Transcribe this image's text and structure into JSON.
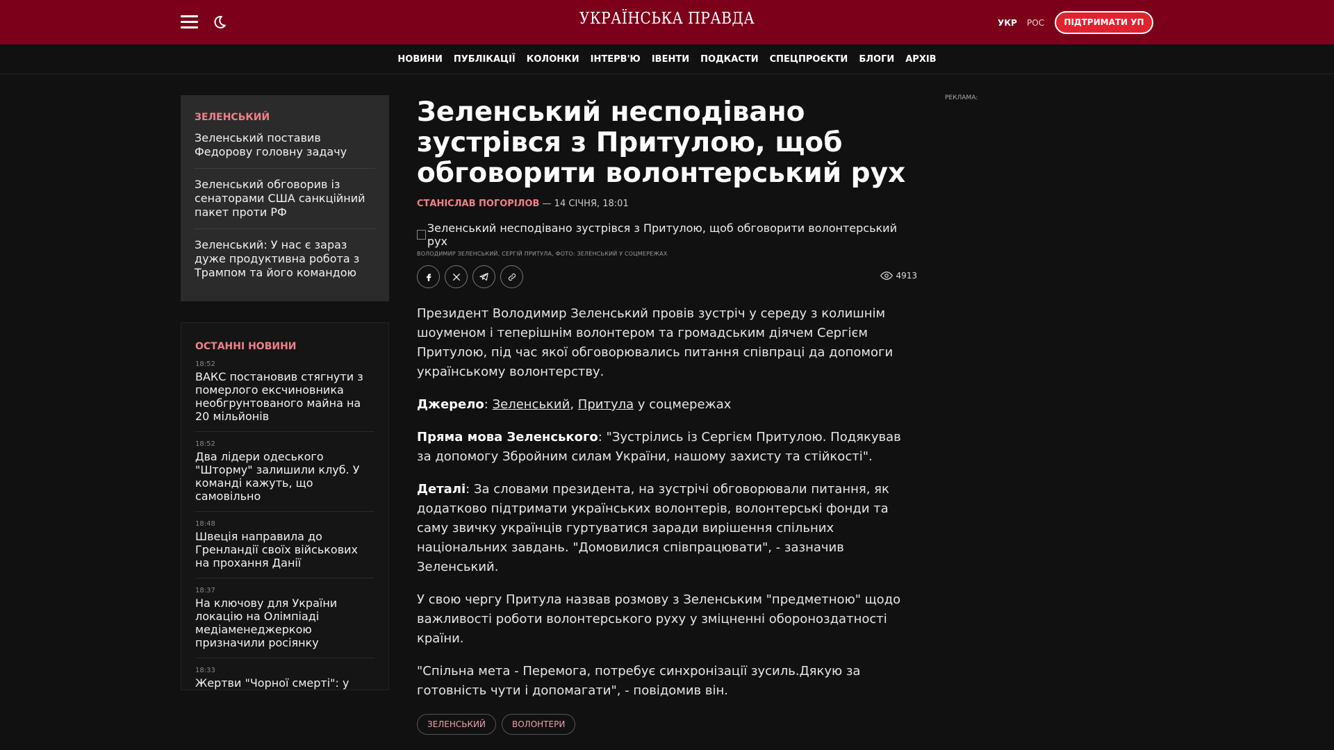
{
  "header": {
    "logo": "УКРАЇНСЬКА ПРАВДА",
    "lang_ukr": "УКР",
    "lang_ros": "РОС",
    "support_label": "ПІДТРИМАТИ УП",
    "accent_color": "#7c0019"
  },
  "nav": {
    "items": [
      "НОВИНИ",
      "ПУБЛІКАЦІЇ",
      "КОЛОНКИ",
      "ІНТЕРВ'Ю",
      "ІВЕНТИ",
      "ПОДКАСТИ",
      "СПЕЦПРОЄКТИ",
      "БЛОГИ",
      "АРХІВ"
    ]
  },
  "topic_box": {
    "title": "ЗЕЛЕНСЬКИЙ",
    "items": [
      "Зеленський поставив Федорову головну задачу",
      "Зеленський обговорив із сенаторами США санкційний пакет проти РФ",
      "Зеленський: У нас є зараз дуже продуктивна робота з Трампом та його командою"
    ]
  },
  "latest": {
    "title": "ОСТАННІ НОВИНИ",
    "items": [
      {
        "time": "18:52",
        "title": "ВАКС постановив стягнути з померлого ексчиновника необгрунтованого майна на 20 мільйонів"
      },
      {
        "time": "18:52",
        "title": "Два лідери одеського \"Шторму\" залишили клуб. У команді кажуть, що самовільно"
      },
      {
        "time": "18:48",
        "title": "Швеція направила до Гренландії своїх військових на прохання Данії"
      },
      {
        "time": "18:37",
        "title": "На ключову для України локацію на Олімпіаді медіаменеджеркою призначили росіянку"
      },
      {
        "time": "18:33",
        "title": "Жертви \"Чорної смерті\": у Німеччині виявили"
      }
    ]
  },
  "article": {
    "headline": "Зеленський несподівано зустрівся з Притулою, щоб обговорити волонтерський рух",
    "author": "СТАНІСЛАВ ПОГОРІЛОВ",
    "date": " — 14 СІЧНЯ, 18:01",
    "photo_alt": "Зеленський несподівано зустрівся з Притулою, щоб обговорити волонтерський рух",
    "caption": "ВОЛОДИМИР ЗЕЛЕНСЬКИЙ, СЕРГІЙ ПРИТУЛА, ФОТО: ЗЕЛЕНСЬКИЙ У СОЦМЕРЕЖАХ",
    "views": "4913",
    "lead": "Президент Володимир Зеленський провів зустріч у середу з колишнім шоуменом і теперішнім волонтером та громадським діячем Сергієм Притулою, під час якої обговорювались питання співпраці да допомоги українському волонтерству.",
    "source_label": "Джерело",
    "source_link1": "Зеленський",
    "source_link2": "Притула",
    "source_tail": " у соцмережах",
    "quote_label": "Пряма мова Зеленського",
    "quote_text": ": \"Зустрілись із Сергієм Притулою. Подякував за допомогу Збройним силам України, нашому захисту та стійкості\".",
    "details_label": "Деталі",
    "details_text": ": За словами президента, на зустрічі обговорювали питання, як додатково підтримати українських волонтерів, волонтерські фонди та саму звичку українців гуртуватися заради вирішення спільних національних завдань. \"Домовилися співпрацювати\", - зазначив Зеленський.",
    "para4": "У свою чергу Притула назвав розмову з Зеленським \"предметною\" щодо важливості роботи волонтерського руху у зміцненні обороноздатності країни.",
    "para5": "\"Спільна мета - Перемога, потребує синхронізації зусиль.Дякую за готовність чути і допомагати\", - повідомив він.",
    "tags": [
      "ЗЕЛЕНСЬКИЙ",
      "ВОЛОНТЕРИ"
    ]
  },
  "ad": {
    "label": "РЕКЛАМА:"
  }
}
